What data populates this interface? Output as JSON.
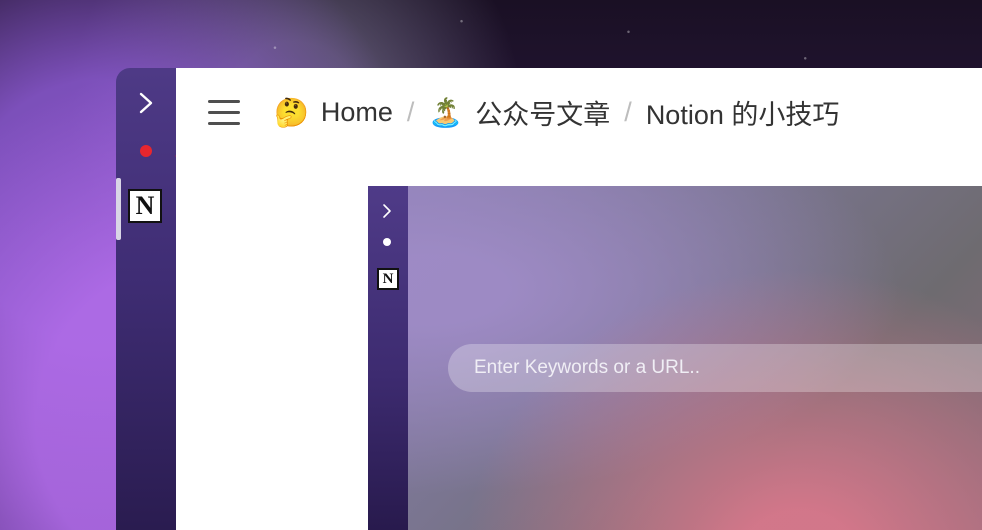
{
  "colors": {
    "notification_dot": "#e8262e",
    "arrow": "#e41e26",
    "sidebar_top": "#4e3a86",
    "sidebar_bottom": "#2a1c50"
  },
  "icons": {
    "expand": "chevron-right-icon",
    "menu": "hamburger-menu-icon",
    "app": "notion-logo-icon"
  },
  "sidebar": {
    "app_logo_letter": "N"
  },
  "breadcrumb": {
    "items": [
      {
        "emoji": "🤔",
        "label": "Home"
      },
      {
        "emoji": "🏝️",
        "label": "公众号文章"
      },
      {
        "emoji": "",
        "label": "Notion 的小技巧"
      }
    ],
    "separator": "/"
  },
  "embedded_screenshot": {
    "app_logo_letter": "N",
    "search_placeholder": "Enter Keywords or a URL.."
  }
}
